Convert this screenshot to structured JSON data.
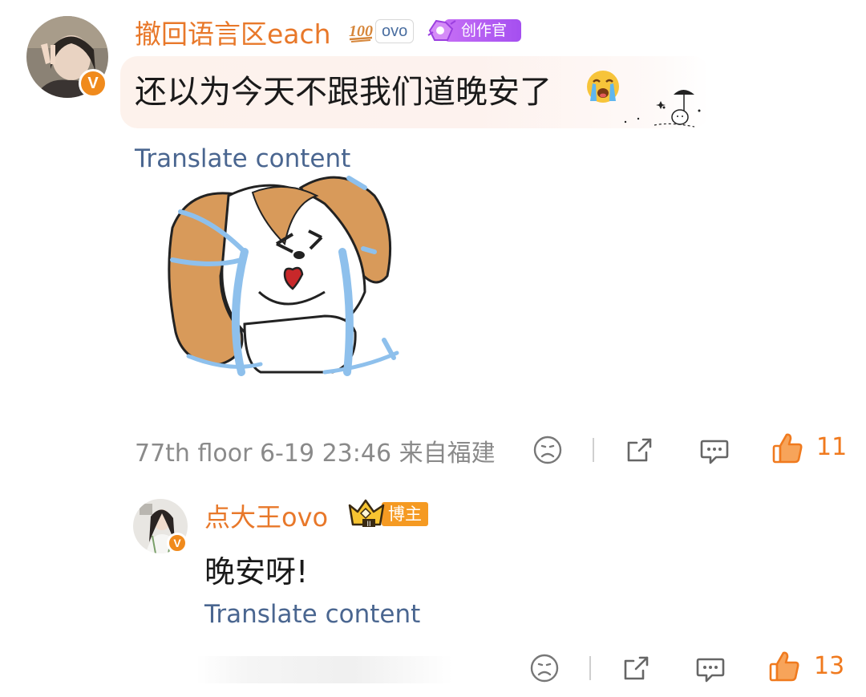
{
  "comment": {
    "username": "撤回语言区each",
    "tag": "ovo",
    "badge_label": "创作官",
    "text": "还以为今天不跟我们道晚安了",
    "translate_label": "Translate content",
    "meta": "77th floor 6-19 23:46 来自福建",
    "like_count": "11"
  },
  "reply": {
    "username": "点大王ovo",
    "badge_label": "博主",
    "text": "晚安呀!",
    "translate_label": "Translate content",
    "like_count": "13"
  },
  "colors": {
    "username": "#e8782a",
    "translate_link": "#4a6690",
    "meta_text": "#8a8a8a",
    "like_active": "#f07a1e",
    "verified_badge": "#f08a1c",
    "creator_badge": "#b45df0",
    "blogger_badge": "#f59a22"
  },
  "icons": {
    "verified": "verified-v-icon",
    "hundred": "hundred-points-icon",
    "emoji": "loudly-crying-face-emoji",
    "reaction": "sad-face-icon",
    "share": "share-icon",
    "comment": "comment-icon",
    "like": "thumbs-up-icon"
  }
}
